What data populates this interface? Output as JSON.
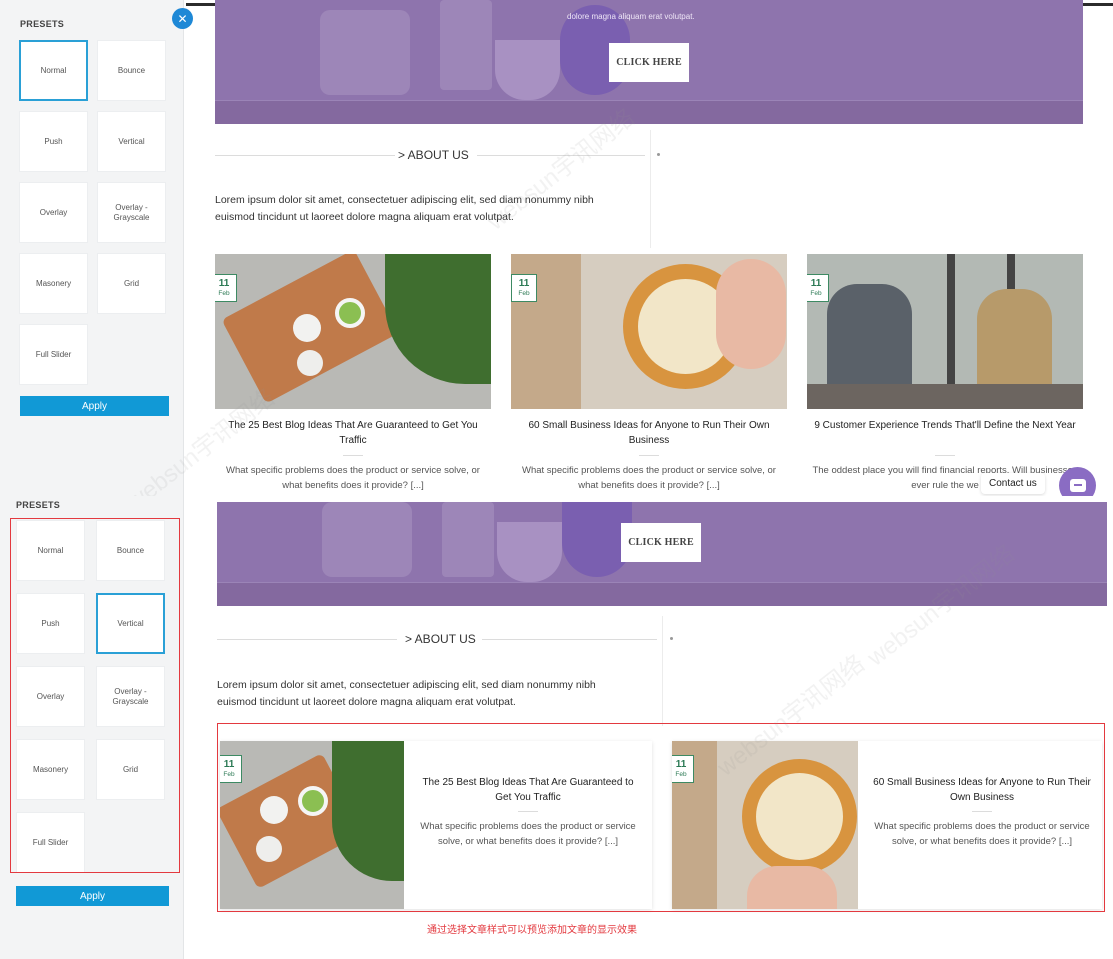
{
  "sidebar": {
    "title": "PRESETS",
    "presets": [
      {
        "label": "Normal"
      },
      {
        "label": "Bounce"
      },
      {
        "label": "Push"
      },
      {
        "label": "Vertical"
      },
      {
        "label": "Overlay"
      },
      {
        "label": "Overlay - Grayscale"
      },
      {
        "label": "Masonery"
      },
      {
        "label": "Grid"
      },
      {
        "label": "Full Slider"
      }
    ],
    "apply_label": "Apply",
    "close_label": "✕"
  },
  "hero": {
    "text": "dolore magna aliquam erat volutpat.",
    "button_label": "CLICK HERE"
  },
  "about": {
    "title": "> ABOUT US",
    "text_line1": "Lorem ipsum dolor sit amet, consectetuer adipiscing elit, sed diam nonummy nibh",
    "text_line2": "euismod tincidunt ut laoreet dolore magna aliquam erat volutpat."
  },
  "posts": [
    {
      "day": "11",
      "month": "Feb",
      "title": "The 25 Best Blog Ideas That Are Guaranteed to Get You Traffic",
      "excerpt": "What specific problems does the product or service solve, or what benefits does it provide? [...]"
    },
    {
      "day": "11",
      "month": "Feb",
      "title": "60 Small Business Ideas for Anyone to Run Their Own Business",
      "excerpt": "What specific problems does the product or service solve, or what benefits does it provide? [...]"
    },
    {
      "day": "11",
      "month": "Feb",
      "title": "9 Customer Experience Trends That'll Define the Next Year",
      "excerpt": "The oddest place you will find financial reports. Will businesses ever rule the we"
    }
  ],
  "contact": {
    "label": "Contact us"
  },
  "caption": "通过选择文章样式可以预览添加文章的显示效果",
  "watermark": "websun宇讯网络",
  "colors": {
    "accent": "#1199d6",
    "hero": "#8e74ad",
    "highlight": "#e3393f",
    "badge": "#3d8a63",
    "chat": "#8a6cc3"
  }
}
